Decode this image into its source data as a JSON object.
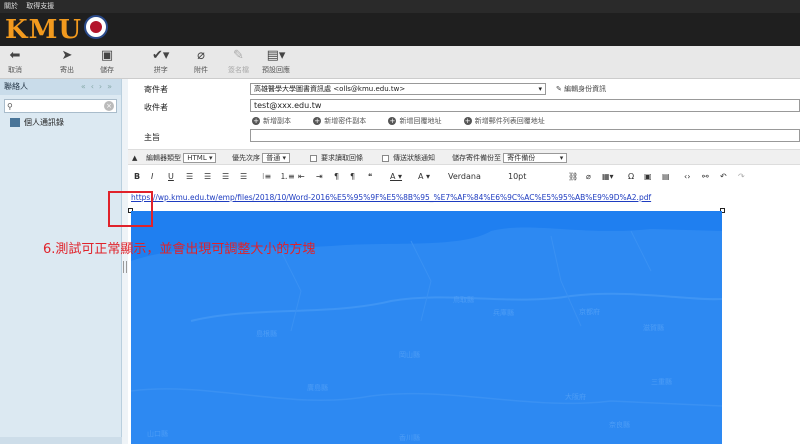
{
  "topbar": {
    "items": [
      "關於",
      "取得支援"
    ]
  },
  "logo": {
    "text": "KMU"
  },
  "toolbar": {
    "cancel": "取消",
    "send": "寄出",
    "save": "儲存",
    "spell": "拼字",
    "attach": "附件",
    "signature": "簽名檔",
    "template": "預設回應"
  },
  "sidebar": {
    "header": "聯絡人",
    "nav": "«‹›»",
    "addressbook": "個人通訊錄"
  },
  "compose": {
    "from_label": "寄件者",
    "from_value": "高雄醫學大學圖書資訊處 <olls@kmu.edu.tw>",
    "edit_identity": "編輯身份資訊",
    "to_label": "收件者",
    "to_value": "test@xxx.edu.tw",
    "add_cc": "新增副本",
    "add_bcc": "新增密件副本",
    "add_reply": "新增回覆地址",
    "add_followup": "新增郵件列表回覆地址",
    "subject_label": "主旨"
  },
  "options": {
    "editor_type_label": "編輯器類型",
    "editor_type_value": "HTML",
    "priority_label": "優先次序",
    "priority_value": "普通",
    "read_receipt": "要求讀取回條",
    "delivery_status": "傳送狀態通知",
    "save_sent_label": "儲存寄件備份至",
    "save_sent_value": "寄件備份"
  },
  "formatting": {
    "font": "Verdana",
    "size": "10pt"
  },
  "body": {
    "link": "https://wp.kmu.edu.tw/emp/files/2018/10/Word-2016%E5%95%9F%E5%8B%95_%E7%AF%84%E6%9C%AC%E5%95%AB%E9%9D%A2.pdf",
    "annotation": "6.測試可正常顯示，並會出現可調整大小的方塊",
    "map_labels": [
      "鳥取縣",
      "島根縣",
      "兵庫縣",
      "京都府",
      "滋賀縣",
      "岡山縣",
      "廣島縣",
      "大阪府",
      "三重縣",
      "奈良縣",
      "香川縣",
      "山口縣"
    ]
  },
  "colors": {
    "accent": "#f29a1e",
    "map": "#1f7ff0",
    "annotation": "#e0222a"
  }
}
